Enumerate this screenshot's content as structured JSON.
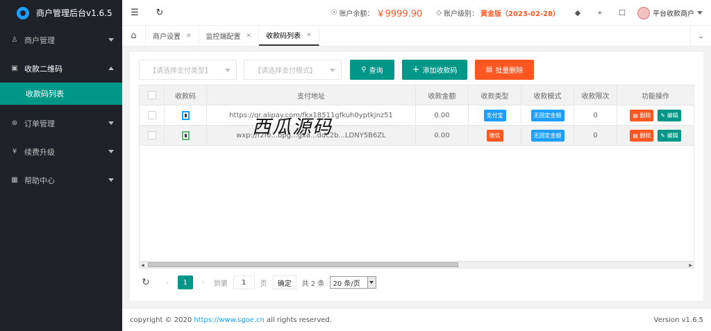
{
  "app": {
    "title": "商户管理后台v1.6.5"
  },
  "sidebar": {
    "items": [
      {
        "label": "商户管理",
        "icon": "user-icon"
      },
      {
        "label": "收款二维码",
        "icon": "image-icon"
      },
      {
        "label": "订单管理",
        "icon": "cart-icon"
      },
      {
        "label": "续费升级",
        "icon": "yen-icon"
      },
      {
        "label": "帮助中心",
        "icon": "help-icon"
      }
    ],
    "subitem": "收款码列表"
  },
  "topbar": {
    "balance_label": "账户余额：",
    "balance_value": "￥9999.90",
    "level_label": "账户级别：",
    "level_value": "黄金版（2023-02-28）",
    "user": "平台收款商户"
  },
  "tabs": [
    {
      "label": "商户设置"
    },
    {
      "label": "监控端配置"
    },
    {
      "label": "收款码列表"
    }
  ],
  "filters": {
    "pay_type": "【请选择支付类型】",
    "pay_mode": "【请选择支付模式】"
  },
  "buttons": {
    "query": "查询",
    "add": "添加收款码",
    "batch_delete": "批量删除"
  },
  "table": {
    "headers": [
      "收款码",
      "支付地址",
      "收款金额",
      "收款类型",
      "收款模式",
      "收款限次",
      "功能操作"
    ],
    "rows": [
      {
        "address": "https://qr.alipay.com/fkx18511gfkuh0yptkjnz51",
        "amount": "0.00",
        "type": "支付宝",
        "mode": "无固定金额",
        "limit": "0"
      },
      {
        "address": "wxp://f2f0...bpg...gxa...ddc2b...LDNY5B6ZL",
        "amount": "0.00",
        "type": "微信",
        "mode": "无固定金额",
        "limit": "0"
      }
    ],
    "actions": {
      "delete": "删除",
      "edit": "编辑"
    }
  },
  "pager": {
    "page": "1",
    "goto_label": "到第",
    "goto_value": "1",
    "page_unit": "页",
    "confirm": "确定",
    "total": "共 2 条",
    "per_page": "20 条/页"
  },
  "watermark": "西瓜源码",
  "footer": {
    "copyright": "copyright © 2020",
    "link": "https://www.sgoe.cn",
    "rights": "all rights reserved.",
    "version": "Version v1.6.5"
  }
}
